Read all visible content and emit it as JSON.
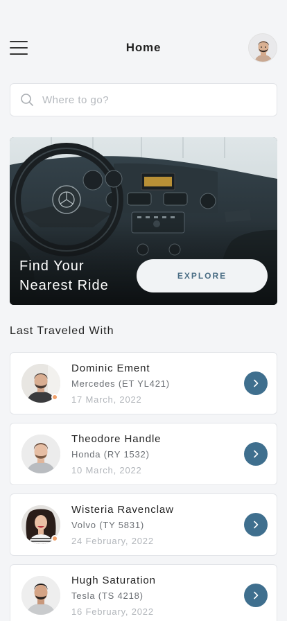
{
  "header": {
    "title": "Home",
    "menu_icon": "hamburger-menu-icon",
    "avatar_icon": "user-avatar"
  },
  "search": {
    "placeholder": "Where to go?",
    "value": ""
  },
  "hero": {
    "title_line1": "Find Your",
    "title_line2": "Nearest Ride",
    "button_label": "EXPLORE"
  },
  "history": {
    "title": "Last Traveled With",
    "items": [
      {
        "name": "Dominic Ement",
        "car": "Mercedes (ET YL421)",
        "date": "17 March, 2022",
        "online": true
      },
      {
        "name": "Theodore Handle",
        "car": "Honda (RY 1532)",
        "date": "10 March, 2022",
        "online": false
      },
      {
        "name": "Wisteria Ravenclaw",
        "car": "Volvo (TY 5831)",
        "date": "24 February, 2022",
        "online": true
      },
      {
        "name": "Hugh Saturation",
        "car": "Tesla (TS 4218)",
        "date": "16 February, 2022",
        "online": false
      }
    ]
  },
  "colors": {
    "accent": "#3f6f8e",
    "background": "#f4f5f7",
    "status_dot": "#f0a06a"
  }
}
